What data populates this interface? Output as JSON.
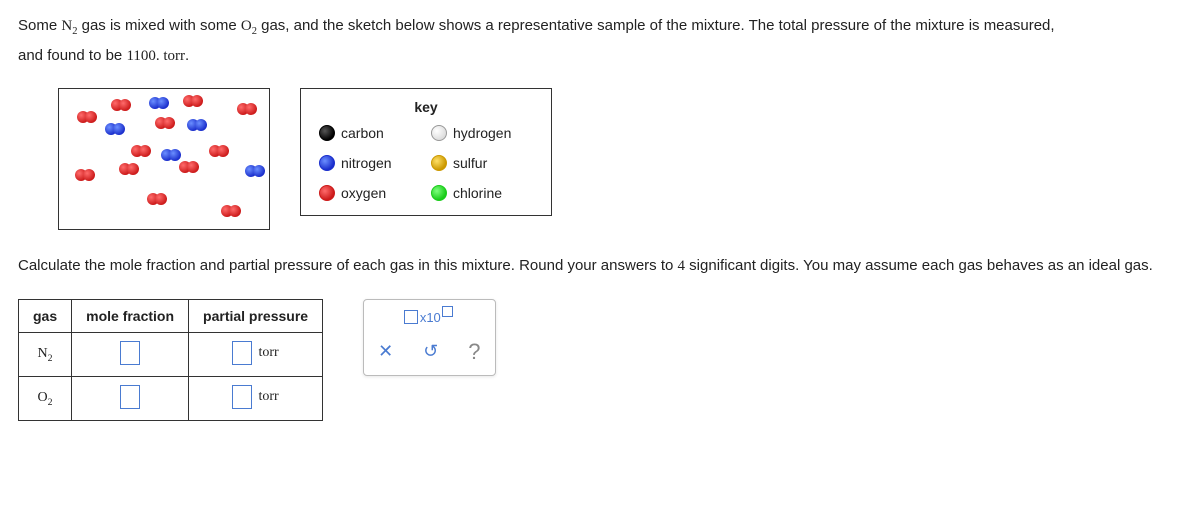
{
  "prompt": {
    "p1a": "Some ",
    "p1_formula_base": "N",
    "p1_formula_sub": "2",
    "p1b": " gas is mixed with some ",
    "p1_formula2_base": "O",
    "p1_formula2_sub": "2",
    "p1c": " gas, and the sketch below shows a representative sample of the mixture. The total pressure of the mixture is measured,",
    "p2": "and found to be ",
    "pressure": "1100. torr",
    "p2end": "."
  },
  "key": {
    "title": "key",
    "carbon": "carbon",
    "nitrogen": "nitrogen",
    "oxygen": "oxygen",
    "hydrogen": "hydrogen",
    "sulfur": "sulfur",
    "chlorine": "chlorine"
  },
  "instruction": {
    "a": "Calculate the mole fraction and partial pressure of each gas in this mixture. Round your answers to ",
    "sig": "4",
    "b": " significant digits. You may assume each gas behaves as an ideal gas."
  },
  "table": {
    "h_gas": "gas",
    "h_mf": "mole fraction",
    "h_pp": "partial pressure",
    "r1_gas_base": "N",
    "r1_gas_sub": "2",
    "r2_gas_base": "O",
    "r2_gas_sub": "2",
    "unit": "torr"
  },
  "tools": {
    "sci_label": "x10",
    "clear": "✕",
    "reset": "↺",
    "help": "?"
  }
}
